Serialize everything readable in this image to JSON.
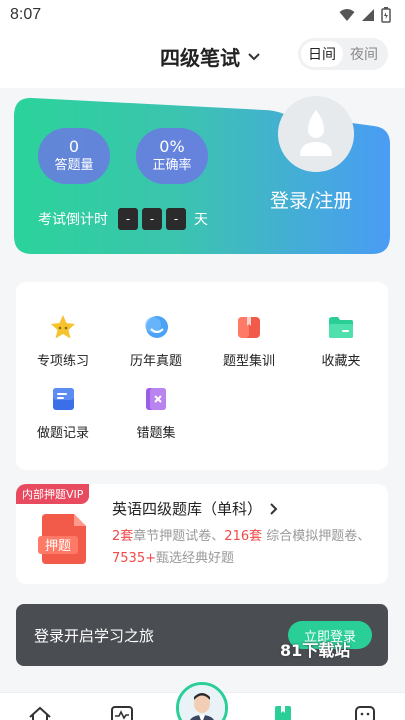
{
  "status_bar": {
    "time": "8:07"
  },
  "header": {
    "exam_name": "四级笔试",
    "mode_day": "日间",
    "mode_night": "夜间"
  },
  "hero": {
    "stat_answers_value": "0",
    "stat_answers_label": "答题量",
    "stat_accuracy_value": "0%",
    "stat_accuracy_label": "正确率",
    "countdown_label": "考试倒计时",
    "countdown_boxes": [
      "-",
      "-",
      "-"
    ],
    "countdown_unit": "天",
    "login_text": "登录/注册"
  },
  "grid": {
    "items": [
      {
        "label": "专项练习",
        "icon": "star-icon"
      },
      {
        "label": "历年真题",
        "icon": "smile-icon"
      },
      {
        "label": "题型集训",
        "icon": "bookmark-icon"
      },
      {
        "label": "收藏夹",
        "icon": "folder-icon"
      },
      {
        "label": "做题记录",
        "icon": "notes-icon"
      },
      {
        "label": "错题集",
        "icon": "wrong-book-icon"
      }
    ]
  },
  "bank": {
    "vip_tag": "内部押题VIP",
    "title": "英语四级题库（单科）",
    "cover_label": "押题",
    "desc_num1": "2套",
    "desc_text1": "章节押题试卷、",
    "desc_num2": "216套",
    "desc_text2": " 综合模拟押题卷、",
    "desc_num3": "7535+",
    "desc_text3": "甄选经典好题"
  },
  "login_banner": {
    "text": "登录开启学习之旅",
    "button": "立即登录"
  },
  "watermark": "81下载站",
  "colors": {
    "accent": "#29cf97",
    "hero_left": "#2bd39a",
    "hero_right": "#4a9cf5",
    "danger": "#f04a4a"
  }
}
